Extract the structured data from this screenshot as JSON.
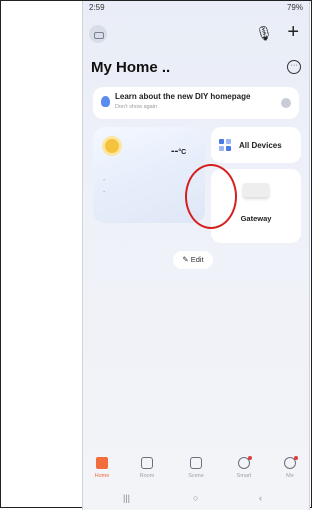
{
  "status_bar": {
    "time": "2:59",
    "right": "79%"
  },
  "home": {
    "title": "My Home .."
  },
  "banner": {
    "title": "Learn about the new DIY homepage",
    "subtitle": "Don't show again"
  },
  "weather": {
    "temperature": "--",
    "unit": "°C",
    "line1": "-",
    "line2": "-"
  },
  "all_devices": {
    "label": "All Devices"
  },
  "device": {
    "name": "Gateway"
  },
  "edit": {
    "label": "Edit",
    "icon": "pencil-icon"
  },
  "tabs": [
    {
      "label": "Home",
      "active": true
    },
    {
      "label": "Room",
      "active": false
    },
    {
      "label": "Scene",
      "active": false
    },
    {
      "label": "Smart",
      "active": false
    },
    {
      "label": "Me",
      "active": false
    }
  ],
  "navbar": {
    "recents": "|||",
    "home": "○",
    "back": "‹"
  },
  "colors": {
    "accent": "#f26d3d",
    "highlight_circle": "#d61f1f",
    "brand_blue": "#4a7ae8"
  }
}
